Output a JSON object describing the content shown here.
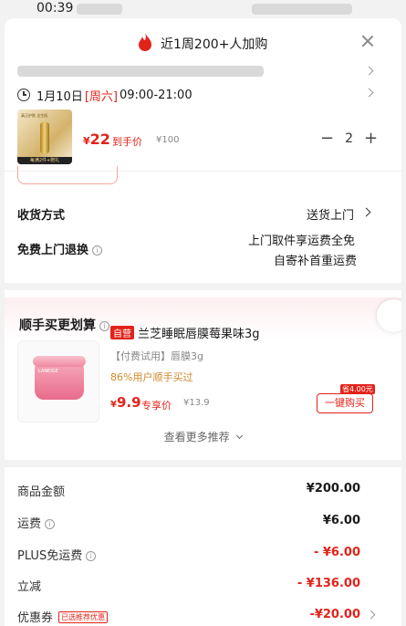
{
  "status_bar": {
    "time": "00:39"
  },
  "header": {
    "title": "近1周200+人加购"
  },
  "delivery": {
    "date": "1月10日",
    "weekday": "[周六]",
    "time_range": "09:00-21:00"
  },
  "product": {
    "image_caption": "真正护肤 全生肌",
    "image_strip": "每满2件+赠礼",
    "currency": "¥",
    "price": "22",
    "price_label": "到手价",
    "original_price": "¥100",
    "quantity": "2",
    "minus": "−",
    "plus": "+"
  },
  "receive": {
    "label": "收货方式",
    "value": "送货上门"
  },
  "free_return": {
    "label": "免费上门退换",
    "line1": "上门取件享运费全免",
    "line2": "自寄补首重运费"
  },
  "recommend": {
    "title": "顺手买更划算",
    "item": {
      "badge": "自营",
      "name": "兰芝睡眠唇膜莓果味3g",
      "brand_on_jar": "LANEIGE",
      "spec": "【付费试用】唇膜3g",
      "popularity": "86%用户顺手买过",
      "currency": "¥",
      "price": "9.9",
      "price_label": "专享价",
      "original_price": "¥13.9",
      "save_tag": "省4.00元",
      "buy_label": "一键购买"
    },
    "more_label": "查看更多推荐"
  },
  "summary": [
    {
      "label": "商品金额",
      "value": "¥200.00",
      "red": false,
      "info": false
    },
    {
      "label": "运费",
      "value": "¥6.00",
      "red": false,
      "info": true
    },
    {
      "label": "PLUS免运费",
      "value": "- ¥6.00",
      "red": true,
      "info": true
    },
    {
      "label": "立减",
      "value": "- ¥136.00",
      "red": true,
      "info": false
    },
    {
      "label": "优惠券",
      "value": "-¥20.00",
      "red": true,
      "info": false,
      "tag": "已选推荐优惠"
    }
  ],
  "colors": {
    "accent": "#e2231a",
    "background": "#f2f2f2"
  }
}
